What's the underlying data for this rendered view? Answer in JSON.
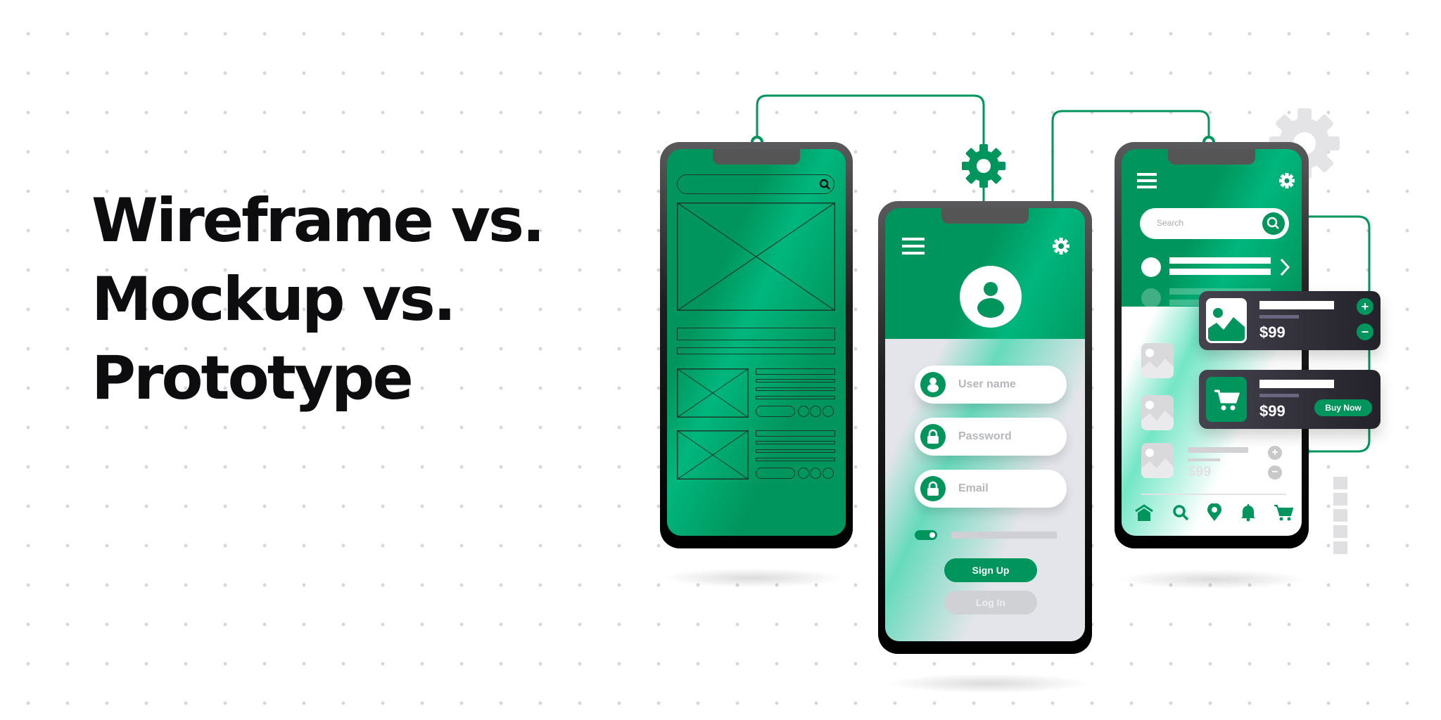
{
  "headline": {
    "lines": [
      "Wireframe vs.",
      "Mockup vs.",
      "Prototype"
    ]
  },
  "colors": {
    "brand_green": "#00955d",
    "text_dark": "#0d0d0f",
    "card_dark": "#2f2d37",
    "muted_gray": "#d9d9dc"
  },
  "mockup_phone": {
    "fields": [
      {
        "label": "User name",
        "icon": "user-icon"
      },
      {
        "label": "Password",
        "icon": "lock-icon"
      },
      {
        "label": "Email",
        "icon": "lock-icon"
      }
    ],
    "toggle_on": true,
    "signup_label": "Sign Up",
    "login_label": "Log In"
  },
  "prototype_phone": {
    "search_placeholder": "Search",
    "cards": [
      {
        "price": "$99",
        "icon": "image-icon",
        "actions": [
          "+",
          "−"
        ]
      },
      {
        "price": "$99",
        "icon": "cart-icon",
        "button": "Buy Now"
      }
    ],
    "list_item_price": "$99",
    "list_actions": [
      "+",
      "−"
    ],
    "nav": [
      "home-icon",
      "search-icon",
      "location-pin-icon",
      "bell-icon",
      "cart-icon"
    ]
  }
}
